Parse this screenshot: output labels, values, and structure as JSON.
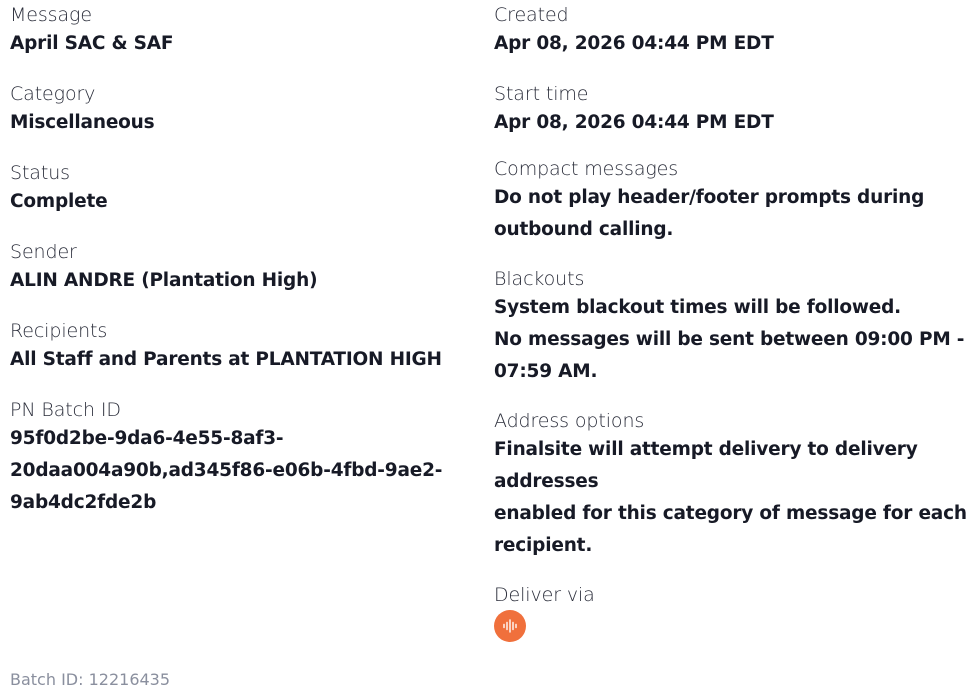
{
  "left": {
    "message": {
      "label": "Message",
      "value": "April SAC & SAF"
    },
    "category": {
      "label": "Category",
      "value": "Miscellaneous"
    },
    "status": {
      "label": "Status",
      "value": "Complete"
    },
    "sender": {
      "label": "Sender",
      "value": "ALIN ANDRE (Plantation High)"
    },
    "recipients": {
      "label": "Recipients",
      "value": "All Staff and Parents at PLANTATION HIGH"
    },
    "pn_batch": {
      "label": "PN Batch ID",
      "lines": [
        "95f0d2be-9da6-4e55-8af3-",
        "20daa004a90b,ad345f86-e06b-4fbd-9ae2-",
        "9ab4dc2fde2b"
      ]
    }
  },
  "right": {
    "created": {
      "label": "Created",
      "value": "Apr 08, 2026 04:44 PM EDT"
    },
    "start_time": {
      "label": "Start time",
      "value": "Apr 08, 2026 04:44 PM EDT"
    },
    "compact": {
      "label": "Compact messages",
      "lines": [
        "Do not play header/footer prompts during",
        "outbound calling."
      ]
    },
    "blackouts": {
      "label": "Blackouts",
      "lines": [
        "System blackout times will be followed.",
        "No messages will be sent between 09:00 PM -",
        "07:59 AM."
      ]
    },
    "address": {
      "label": "Address options",
      "lines": [
        "Finalsite will attempt delivery to delivery addresses",
        "enabled for this category of message for each",
        "recipient."
      ]
    },
    "deliver_via": {
      "label": "Deliver via",
      "icons": [
        "voice-waveform-icon"
      ],
      "icon_color": "#f0703c"
    }
  },
  "footer": {
    "batch_id": "Batch ID: 12216435"
  }
}
